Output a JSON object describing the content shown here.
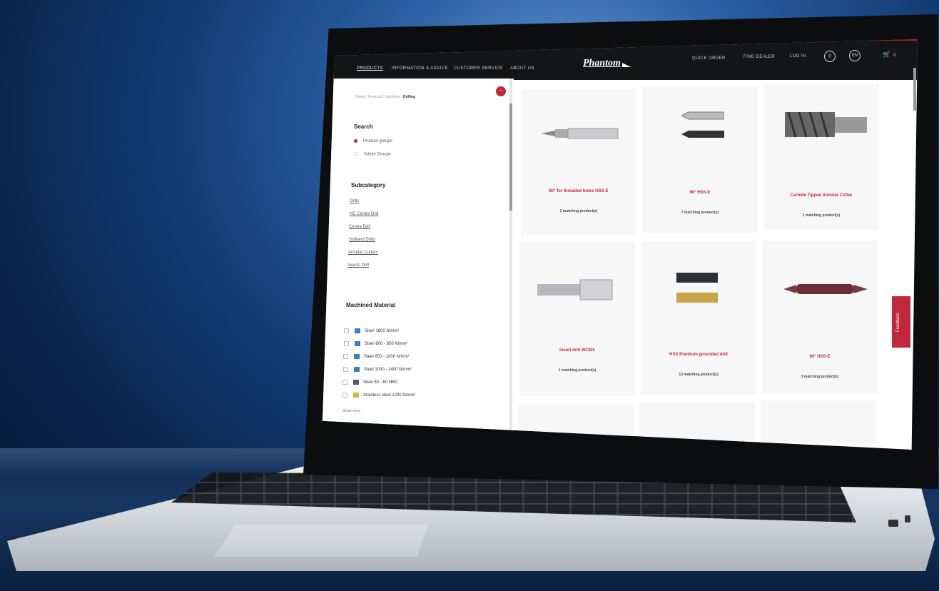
{
  "nav": {
    "left": [
      "PRODUCTS",
      "INFORMATION & ADVICE",
      "CUSTOMER SERVICE",
      "ABOUT US"
    ],
    "logo": "Phantom",
    "right": [
      "QUICK ORDER",
      "FIND DEALER",
      "LOG IN"
    ],
    "language": "EN",
    "cart_count": "0"
  },
  "sidebar": {
    "breadcrumb": [
      "Home",
      "Products",
      "Machines",
      "Drilling"
    ],
    "search_heading": "Search",
    "search_options": [
      {
        "label": "Product groups",
        "selected": true
      },
      {
        "label": "Article Groups",
        "selected": false
      }
    ],
    "subcategory_heading": "Subcategory",
    "subcategories": [
      "Drills",
      "NC Centre Drill",
      "Centre Drill",
      "Solitaird Drills",
      "Annular Cutters",
      "Inserts Drill"
    ],
    "material_heading": "Machined Material",
    "materials": [
      "Steel 1600 N/mm²",
      "Steel 600 - 850 N/mm²",
      "Steel 850 - 1000 N/mm²",
      "Steel 1000 - 1400 N/mm²",
      "Steel 50 - 60 HRC",
      "Stainless steel 1200 N/mm²"
    ],
    "show_more": "Show more"
  },
  "products": [
    {
      "title": "60° for threaded holes HSS-E",
      "count": "2 matching product(s)"
    },
    {
      "title": "90° HSS-E",
      "count": "7 matching product(s)"
    },
    {
      "title": "Carbide Tipped Annular Cutter",
      "count": "1 matching product(s)"
    },
    {
      "title": "Insert drill WCMX",
      "count": "1 matching product(s)"
    },
    {
      "title": "HSS Premium grounded drill",
      "count": "13 matching product(s)"
    },
    {
      "title": "60° HSS-E",
      "count": "3 matching product(s)"
    }
  ],
  "feedback_label": "Feedback",
  "colors": {
    "accent": "#c2283b",
    "nav_bg": "#141517"
  }
}
